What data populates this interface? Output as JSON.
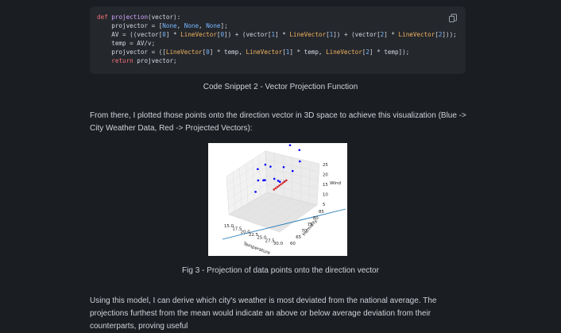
{
  "code_block": {
    "lines": [
      [
        {
          "t": "def ",
          "c": "kw"
        },
        {
          "t": "projection",
          "c": "fn"
        },
        {
          "t": "(vector):",
          "c": ""
        }
      ],
      [
        {
          "t": "    projvector = [",
          "c": ""
        },
        {
          "t": "None",
          "c": "cnst"
        },
        {
          "t": ", ",
          "c": ""
        },
        {
          "t": "None",
          "c": "cnst"
        },
        {
          "t": ", ",
          "c": ""
        },
        {
          "t": "None",
          "c": "cnst"
        },
        {
          "t": "];",
          "c": ""
        }
      ],
      [
        {
          "t": "    AV = ((vector[",
          "c": ""
        },
        {
          "t": "0",
          "c": "num"
        },
        {
          "t": "] * ",
          "c": ""
        },
        {
          "t": "LineVector",
          "c": "cls"
        },
        {
          "t": "[",
          "c": ""
        },
        {
          "t": "0",
          "c": "num"
        },
        {
          "t": "]) + (vector[",
          "c": ""
        },
        {
          "t": "1",
          "c": "num"
        },
        {
          "t": "] * ",
          "c": ""
        },
        {
          "t": "LineVector",
          "c": "cls"
        },
        {
          "t": "[",
          "c": ""
        },
        {
          "t": "1",
          "c": "num"
        },
        {
          "t": "]) + (vector[",
          "c": ""
        },
        {
          "t": "2",
          "c": "num"
        },
        {
          "t": "] * ",
          "c": ""
        },
        {
          "t": "LineVector",
          "c": "cls"
        },
        {
          "t": "[",
          "c": ""
        },
        {
          "t": "2",
          "c": "num"
        },
        {
          "t": "]));",
          "c": ""
        }
      ],
      [
        {
          "t": "    temp = AV/v;",
          "c": ""
        }
      ],
      [
        {
          "t": "    projvector = ([",
          "c": ""
        },
        {
          "t": "LineVector",
          "c": "cls"
        },
        {
          "t": "[",
          "c": ""
        },
        {
          "t": "0",
          "c": "num"
        },
        {
          "t": "] * temp, ",
          "c": ""
        },
        {
          "t": "LineVector",
          "c": "cls"
        },
        {
          "t": "[",
          "c": ""
        },
        {
          "t": "1",
          "c": "num"
        },
        {
          "t": "] * temp, ",
          "c": ""
        },
        {
          "t": "LineVector",
          "c": "cls"
        },
        {
          "t": "[",
          "c": ""
        },
        {
          "t": "2",
          "c": "num"
        },
        {
          "t": "] * temp]);",
          "c": ""
        }
      ],
      [
        {
          "t": "    ",
          "c": ""
        },
        {
          "t": "return",
          "c": "kw"
        },
        {
          "t": " projvector;",
          "c": ""
        }
      ]
    ],
    "copy_icon": "copy-icon"
  },
  "captions": {
    "snippet": "Code Snippet 2 - Vector Projection Function",
    "figure": "Fig 3 - Projection of data points onto the direction vector"
  },
  "paragraphs": {
    "intro": "From there, I plotted those points onto the direction vector in 3D space to achieve this visualization (Blue -> City Weather Data, Red -> Projected Vectors):",
    "outro": "Using this model, I can derive which city's weather is most deviated from the national average. The projections furthest from the mean would indicate an above or below average deviation from their counterparts, proving useful"
  },
  "colors": {
    "background": "#1a1d21",
    "code_bg": "#24272c",
    "data_points": "#0000ff",
    "projected_points": "#d62728",
    "direction_line": "#1f77b4"
  },
  "chart_data": {
    "type": "scatter",
    "projection": "3d",
    "xlabel": "Temperature",
    "ylabel": "Humidity",
    "zlabel": "Wind",
    "x_ticks": [
      "15.0",
      "17.5",
      "20.0",
      "22.5",
      "25.0",
      "27.5",
      "30.0"
    ],
    "y_ticks": [
      "60",
      "65",
      "70",
      "75",
      "80",
      "85"
    ],
    "z_ticks": [
      "5",
      "10",
      "15",
      "20",
      "25"
    ],
    "xlim": [
      15,
      30
    ],
    "ylim": [
      60,
      85
    ],
    "zlim": [
      5,
      25
    ],
    "series": [
      {
        "marker": "blue-dots",
        "points": [
          [
            24,
            64,
            22
          ],
          [
            26,
            76,
            24
          ],
          [
            20,
            68,
            20
          ],
          [
            22,
            72,
            18
          ],
          [
            27,
            80,
            19
          ],
          [
            23,
            66,
            14
          ],
          [
            25,
            74,
            15
          ],
          [
            21,
            70,
            13
          ],
          [
            28,
            78,
            14
          ],
          [
            24,
            70,
            12
          ],
          [
            26,
            68,
            11
          ],
          [
            22,
            62,
            11
          ],
          [
            19,
            74,
            12
          ],
          [
            25,
            80,
            10
          ],
          [
            23,
            76,
            8
          ],
          [
            27,
            70,
            9
          ],
          [
            21,
            66,
            15
          ]
        ]
      },
      {
        "marker": "red-dots",
        "points": [
          [
            22.8,
            72.5,
            6.2
          ],
          [
            23.1,
            73.0,
            6.4
          ],
          [
            23.4,
            73.5,
            6.6
          ],
          [
            23.7,
            74.0,
            6.8
          ],
          [
            24.0,
            74.5,
            7.0
          ],
          [
            24.3,
            75.0,
            7.2
          ],
          [
            24.6,
            75.5,
            7.4
          ],
          [
            24.9,
            76.0,
            7.6
          ]
        ]
      }
    ],
    "line": {
      "from": [
        15,
        60,
        2
      ],
      "to": [
        30,
        85,
        12
      ]
    },
    "grid": true
  }
}
